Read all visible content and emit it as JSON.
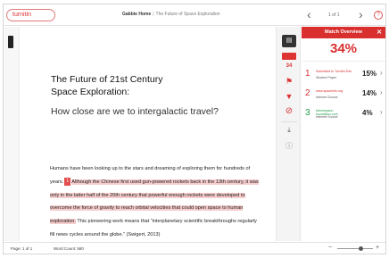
{
  "header": {
    "logo_text": "turnitin",
    "title": "Gabbie Home",
    "subtitle": "The Future of Space Exploration",
    "page_indicator": "1 of 1",
    "help": "?"
  },
  "document": {
    "title": "The Future of 21st Century\nSpace Exploration:",
    "subtitle": "How close are we to intergalactic travel?",
    "marker": "1",
    "paragraph": {
      "p1": "Humans have been looking up to the stars and dreaming of exploring them for hundreds of years.",
      "p2": "Although the Chinese first used gun-powered rockets back in the 13th century, it was only in the latter half of the 20th century that powerful enough rockets were developed to overcome the force of gravity to reach orbital velocities that could open space to human exploration.",
      "p3": " This pioneering work means that “interplanetary scientific breakthroughs regularly fill news cycles around the globe.” (Swigert, 2013)"
    }
  },
  "tools": {
    "match_badge": "34",
    "doc_icon": "document-icon",
    "flag_icon": "flag-icon",
    "filter_icon": "filter-icon",
    "block_icon": "exclude-icon",
    "download_icon": "download-icon",
    "info_icon": "info-icon"
  },
  "panel": {
    "title": "Match Overview",
    "overall": "34%",
    "matches": [
      {
        "num": "1",
        "source": "Submitted to Turnitin.Edu",
        "type": "Student Paper",
        "pct": "15%",
        "color": "#d92f2f"
      },
      {
        "num": "2",
        "source": "www.spaceinfo.org",
        "type": "Internet Source",
        "pct": "14%",
        "color": "#d92f2f"
      },
      {
        "num": "3",
        "source": "futurespace-foundation.com",
        "type": "Internet Source",
        "pct": "4%",
        "color": "#1f9a4b"
      }
    ]
  },
  "status": {
    "page": "Page: 1 of 1",
    "words": "Word Count: 580",
    "zoom_level": 0.65
  },
  "colors": {
    "accent": "#d92f2f",
    "highlight": "#f6cccc",
    "green": "#1f9a4b"
  }
}
